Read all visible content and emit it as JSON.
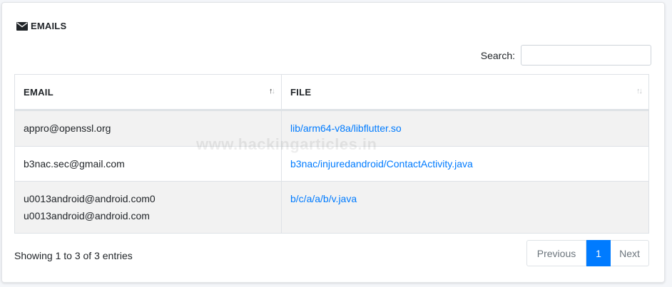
{
  "card": {
    "title": "EMAILS",
    "icon": "envelope-icon"
  },
  "search": {
    "label": "Search:",
    "value": "",
    "placeholder": ""
  },
  "table": {
    "columns": [
      "EMAIL",
      "FILE"
    ],
    "rows": [
      {
        "emails": [
          "appro@openssl.org"
        ],
        "file": "lib/arm64-v8a/libflutter.so"
      },
      {
        "emails": [
          "b3nac.sec@gmail.com"
        ],
        "file": "b3nac/injuredandroid/ContactActivity.java"
      },
      {
        "emails": [
          "u0013android@android.com0",
          "u0013android@android.com"
        ],
        "file": "b/c/a/a/b/v.java"
      }
    ]
  },
  "info": "Showing 1 to 3 of 3 entries",
  "pagination": {
    "previous": "Previous",
    "current": "1",
    "next": "Next"
  },
  "watermark": "www.hackingarticles.in",
  "colors": {
    "accent": "#007bff",
    "stripe": "#f2f2f2",
    "border": "#dee2e6"
  }
}
